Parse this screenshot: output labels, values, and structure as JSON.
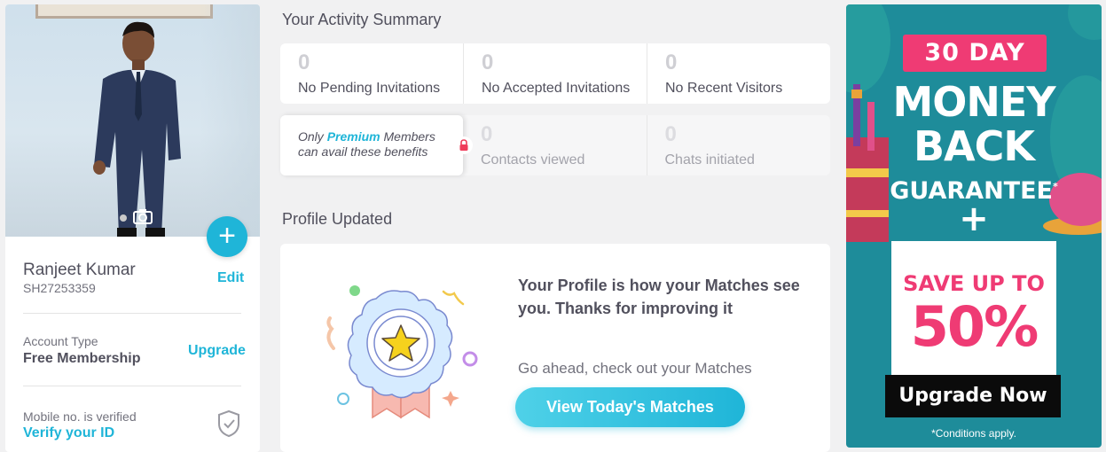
{
  "profile": {
    "name": "Ranjeet Kumar",
    "id": "SH27253359",
    "edit_label": "Edit",
    "add_icon": "+",
    "account_type_label": "Account Type",
    "account_type_value": "Free Membership",
    "upgrade_label": "Upgrade",
    "mobile_status": "Mobile no. is verified",
    "verify_id_label": "Verify your ID"
  },
  "activity": {
    "title": "Your Activity Summary",
    "row1": [
      {
        "count": "0",
        "label": "No Pending Invitations"
      },
      {
        "count": "0",
        "label": "No Accepted Invitations"
      },
      {
        "count": "0",
        "label": "No Recent Visitors"
      }
    ],
    "premium_note": {
      "prefix": "Only ",
      "highlight": "Premium",
      "suffix": " Members",
      "line2": "can avail these benefits"
    },
    "row2": [
      {
        "count": "0",
        "label": "Contacts viewed"
      },
      {
        "count": "0",
        "label": "Chats initiated"
      }
    ]
  },
  "profile_updated": {
    "title": "Profile Updated",
    "headline": "Your Profile is how your Matches see you. Thanks for improving it",
    "subtext": "Go ahead, check out your Matches",
    "button_label": "View Today's Matches"
  },
  "promo": {
    "days": "30 DAY",
    "line1": "MONEY",
    "line2": "BACK",
    "line3": "GUARANTEE",
    "asterisk": "*",
    "plus": "+",
    "save_text": "SAVE UP TO",
    "save_percent": "50%",
    "button_label": "Upgrade Now",
    "conditions": "*Conditions apply."
  },
  "colors": {
    "accent": "#1fb5d8",
    "pink": "#ef3b74",
    "promo_bg": "#1e8c9a"
  }
}
